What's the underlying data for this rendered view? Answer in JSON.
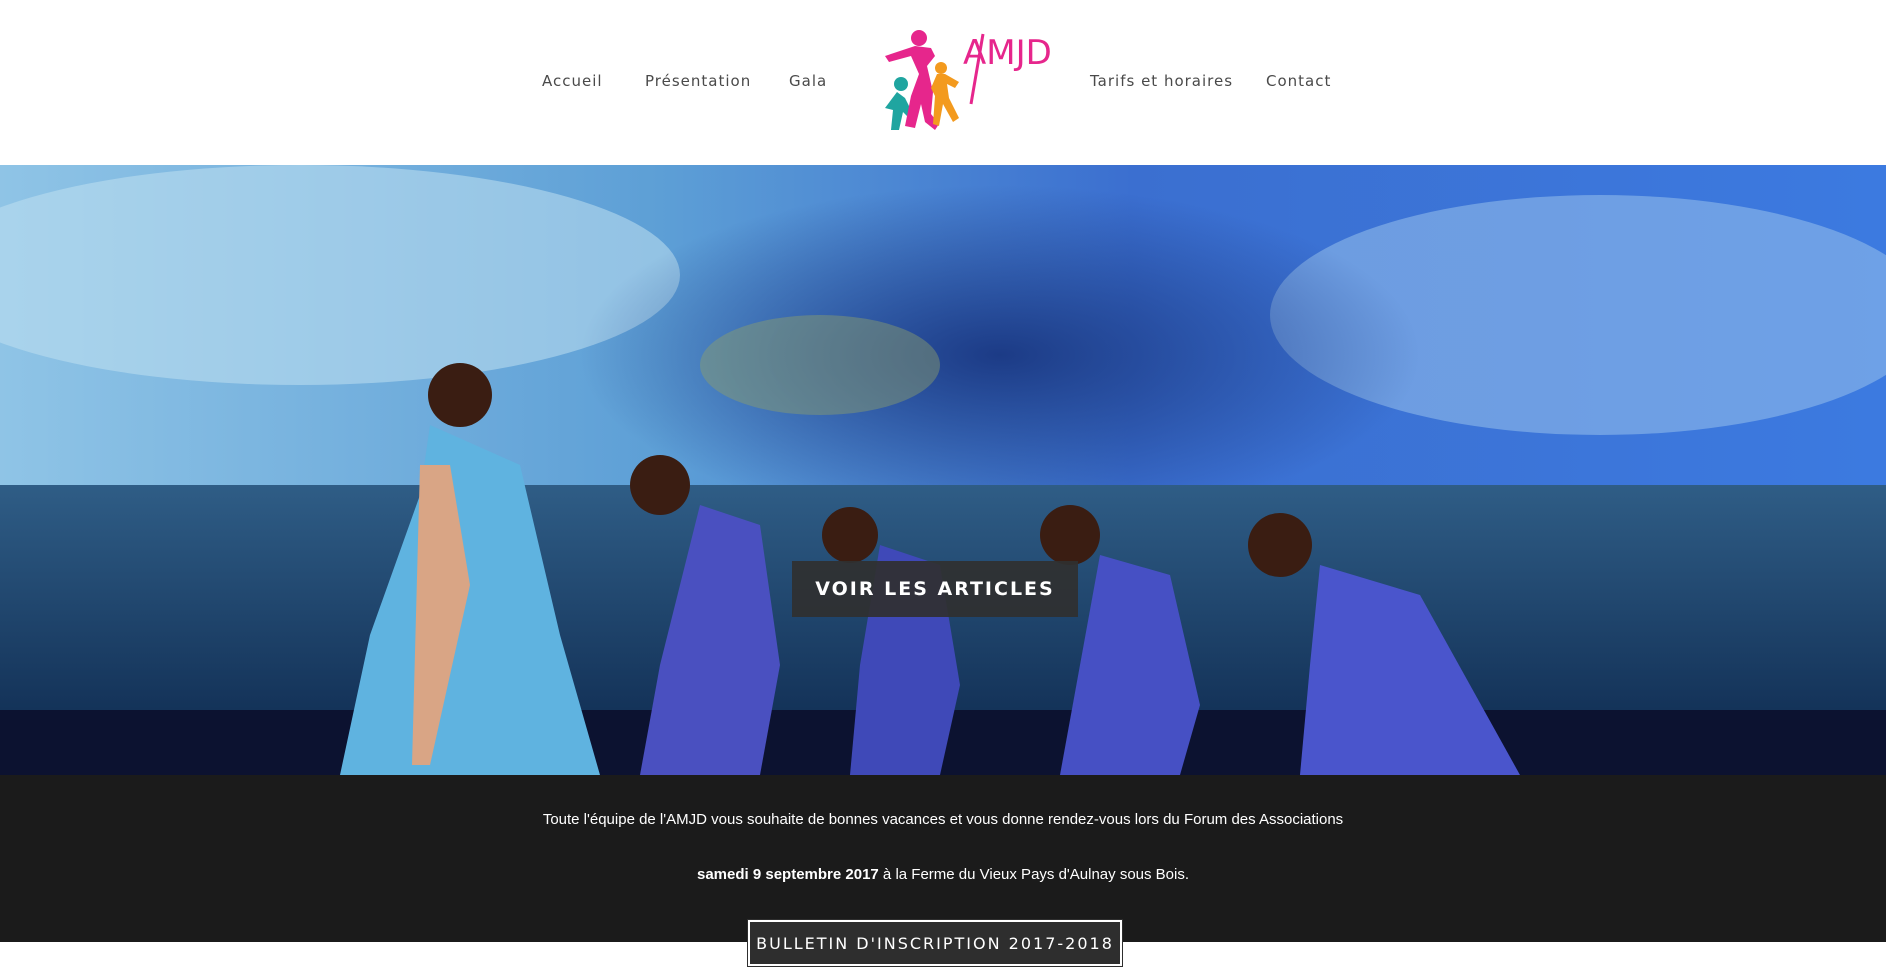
{
  "nav": {
    "left": [
      "Accueil",
      "Présentation",
      "Gala"
    ],
    "right": [
      "Tarifs et horaires",
      "Contact"
    ]
  },
  "logo": {
    "text": "AMJD",
    "icon": "dancers-logo-icon"
  },
  "hero": {
    "button_label": "VOIR LES ARTICLES",
    "image": "dancers-on-stage-photo"
  },
  "info": {
    "line1": "Toute l'équipe de l'AMJD vous souhaite de bonnes vacances et vous donne rendez-vous lors du Forum des Associations",
    "line2_bold": "samedi 9 septembre 2017",
    "line2_rest": " à la Ferme du Vieux Pays d'Aulnay sous Bois."
  },
  "register": {
    "button_label": "BULLETIN D'INSCRIPTION 2017-2018"
  },
  "colors": {
    "brand_pink": "#e6268c",
    "brand_green": "#8cc63f",
    "brand_orange": "#f39a1e",
    "brand_teal": "#1fa5a0",
    "band_dark": "#1b1b1b"
  }
}
